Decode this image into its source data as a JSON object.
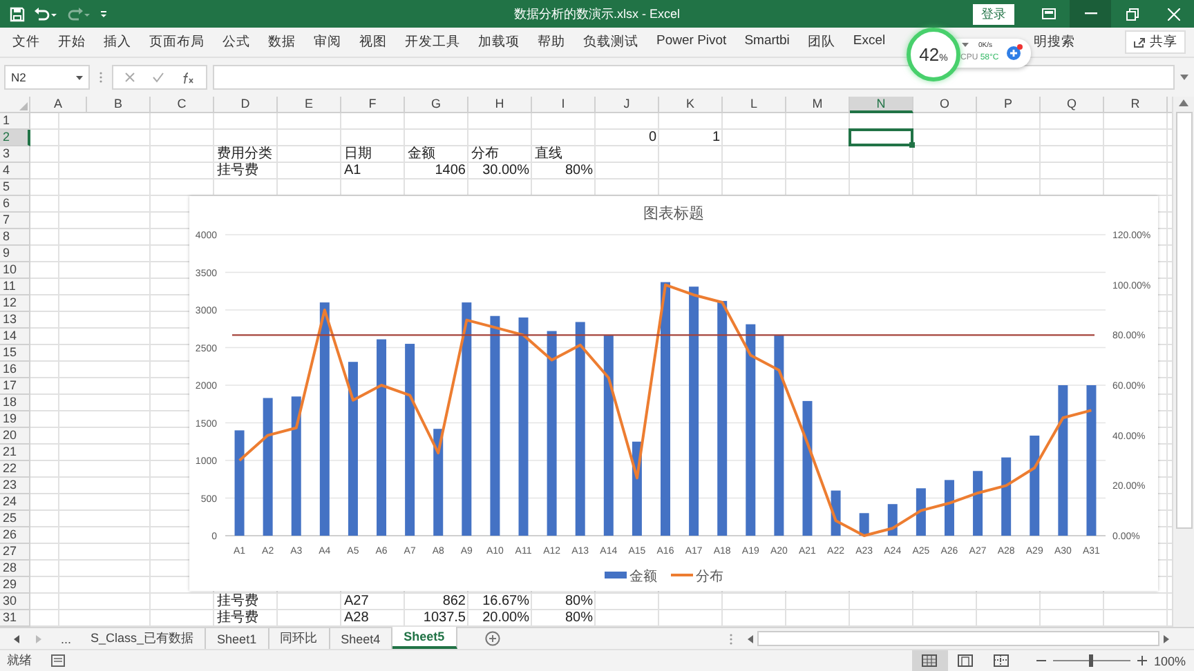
{
  "title_bar": {
    "title": "数据分析的数演示.xlsx - Excel",
    "login": "登录"
  },
  "ribbon": {
    "tabs": [
      "文件",
      "开始",
      "插入",
      "页面布局",
      "公式",
      "数据",
      "审阅",
      "视图",
      "开发工具",
      "加载项",
      "帮助",
      "负载测试",
      "Power Pivot",
      "Smartbi",
      "团队",
      "Excel"
    ],
    "search": "明搜索",
    "share": "共享"
  },
  "monitor": {
    "usage": "42",
    "unit": "%",
    "speed": "0K/s",
    "cpu_label": "CPU",
    "cpu_temp": "58°C"
  },
  "formula_bar": {
    "name_box": "N2"
  },
  "grid": {
    "columns": [
      {
        "label": "A",
        "selected": false
      },
      {
        "label": "B",
        "selected": false
      },
      {
        "label": "C",
        "selected": false
      },
      {
        "label": "D",
        "selected": false
      },
      {
        "label": "E",
        "selected": false
      },
      {
        "label": "F",
        "selected": false
      },
      {
        "label": "G",
        "selected": false
      },
      {
        "label": "H",
        "selected": false
      },
      {
        "label": "I",
        "selected": false
      },
      {
        "label": "J",
        "selected": false
      },
      {
        "label": "K",
        "selected": false
      },
      {
        "label": "L",
        "selected": false
      },
      {
        "label": "M",
        "selected": false
      },
      {
        "label": "N",
        "selected": true
      },
      {
        "label": "O",
        "selected": false
      },
      {
        "label": "P",
        "selected": false
      },
      {
        "label": "Q",
        "selected": false
      },
      {
        "label": "R",
        "selected": false
      }
    ],
    "rows": [
      {
        "number": "1",
        "selected": false
      },
      {
        "number": "2",
        "selected": true,
        "numbers": {
          "J": "0",
          "K": "1"
        }
      },
      {
        "number": "3",
        "selected": false,
        "cells": {
          "D": "费用分类",
          "F": "日期",
          "G": "金额",
          "H": "分布",
          "I": "直线"
        }
      },
      {
        "number": "4",
        "selected": false,
        "cells": {
          "D": "挂号费",
          "F": "A1"
        },
        "numbers": {
          "G": "1406",
          "H": "30.00%",
          "I": "80%"
        }
      },
      {
        "number": "5",
        "selected": false
      },
      {
        "number": "6",
        "selected": false
      },
      {
        "number": "7",
        "selected": false
      },
      {
        "number": "8",
        "selected": false
      },
      {
        "number": "9",
        "selected": false
      },
      {
        "number": "10",
        "selected": false
      },
      {
        "number": "11",
        "selected": false
      },
      {
        "number": "12",
        "selected": false
      },
      {
        "number": "13",
        "selected": false
      },
      {
        "number": "14",
        "selected": false
      },
      {
        "number": "15",
        "selected": false
      },
      {
        "number": "16",
        "selected": false
      },
      {
        "number": "17",
        "selected": false
      },
      {
        "number": "18",
        "selected": false
      },
      {
        "number": "19",
        "selected": false
      },
      {
        "number": "20",
        "selected": false
      },
      {
        "number": "21",
        "selected": false
      },
      {
        "number": "22",
        "selected": false
      },
      {
        "number": "23",
        "selected": false
      },
      {
        "number": "24",
        "selected": false
      },
      {
        "number": "25",
        "selected": false
      },
      {
        "number": "26",
        "selected": false
      },
      {
        "number": "27",
        "selected": false
      },
      {
        "number": "28",
        "selected": false
      },
      {
        "number": "29",
        "selected": false
      },
      {
        "number": "30",
        "selected": false,
        "cells": {
          "D": "挂号费",
          "F": "A27"
        },
        "numbers": {
          "G": "862",
          "H": "16.67%",
          "I": "80%"
        }
      },
      {
        "number": "31",
        "selected": false,
        "cells": {
          "D": "挂号费",
          "F": "A28"
        },
        "numbers": {
          "G": "1037.5",
          "H": "20.00%",
          "I": "80%"
        }
      }
    ]
  },
  "chart": {
    "chart_data": {
      "type": "bar",
      "title": "图表标题",
      "categories": [
        "A1",
        "A2",
        "A3",
        "A4",
        "A5",
        "A6",
        "A7",
        "A8",
        "A9",
        "A10",
        "A11",
        "A12",
        "A13",
        "A14",
        "A15",
        "A16",
        "A17",
        "A18",
        "A19",
        "A20",
        "A21",
        "A22",
        "A23",
        "A24",
        "A25",
        "A26",
        "A27",
        "A28",
        "A29",
        "A30",
        "A31"
      ],
      "grid": true,
      "legend": true,
      "series": [
        {
          "name": "金额",
          "color": "#4472c4",
          "values": [
            1400,
            1830,
            1850,
            3100,
            2310,
            2610,
            2550,
            1420,
            3100,
            2920,
            2900,
            2720,
            2840,
            2660,
            1250,
            3370,
            3310,
            3120,
            2810,
            2660,
            1790,
            600,
            300,
            420,
            630,
            740,
            860,
            1040,
            1330,
            2000,
            2000
          ]
        },
        {
          "name": "分布",
          "color": "#ed7d31",
          "type": "line",
          "axis": "y2",
          "values": [
            30,
            40,
            43,
            90,
            54,
            60,
            56,
            33,
            86,
            83,
            80,
            70,
            76,
            63,
            23,
            100,
            96,
            93,
            72,
            66,
            37,
            6,
            0,
            3,
            10,
            13,
            17,
            20,
            27,
            47,
            50
          ]
        }
      ],
      "ylim": [
        0,
        4000
      ],
      "yticks": [
        {
          "value": 0,
          "label": "0"
        },
        500,
        1000,
        1500,
        2000,
        2500,
        3000,
        3500,
        4000
      ],
      "y2lim": [
        0,
        120
      ],
      "y2ticks": [
        {
          "value": 0,
          "label": "0.00%"
        },
        {
          "value": 20,
          "label": "20.00%"
        },
        {
          "value": 40,
          "label": "40.00%"
        },
        {
          "value": 60,
          "label": "60.00%"
        },
        {
          "value": 80,
          "label": "80.00%"
        },
        {
          "value": 100,
          "label": "100.00%"
        },
        {
          "value": 120,
          "label": "120.00%"
        }
      ],
      "ref_lines": [
        {
          "value": 80,
          "axis": "y2",
          "color": "#a5433a"
        }
      ]
    }
  },
  "sheet_tabs": {
    "overflow": "...",
    "items": [
      {
        "label": "S_Class_已有数据",
        "selected": false
      },
      {
        "label": "Sheet1",
        "selected": false
      },
      {
        "label": "同环比",
        "selected": false
      },
      {
        "label": "Sheet4",
        "selected": false
      },
      {
        "label": "Sheet5",
        "selected": true
      }
    ]
  },
  "status_bar": {
    "status": "就绪",
    "views": [
      {
        "kind": "normal",
        "selected": true
      },
      {
        "kind": "page_layout",
        "selected": false
      },
      {
        "kind": "page_break",
        "selected": false
      }
    ],
    "zoom": {
      "level": 0.5,
      "reading": "100%"
    }
  }
}
